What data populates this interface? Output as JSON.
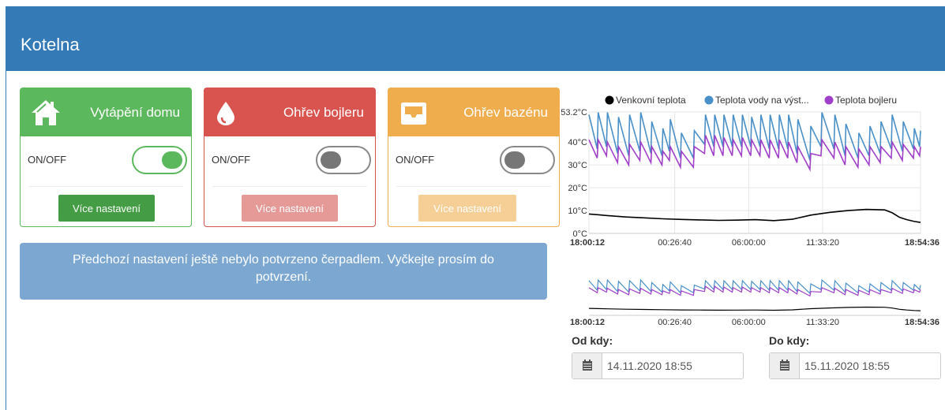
{
  "header": {
    "title": "Kotelna"
  },
  "cards": [
    {
      "title": "Vytápění domu",
      "toggle_label": "ON/OFF",
      "toggle_on": true,
      "button_label": "Více nastavení",
      "icon": "home-icon"
    },
    {
      "title": "Ohřev bojleru",
      "toggle_label": "ON/OFF",
      "toggle_on": false,
      "button_label": "Více nastavení",
      "icon": "water-drop-icon"
    },
    {
      "title": "Ohřev bazénu",
      "toggle_label": "ON/OFF",
      "toggle_on": false,
      "button_label": "Více nastavení",
      "icon": "inbox-tray-icon"
    }
  ],
  "alert": {
    "text": "Předchozí nastavení ještě nebylo potvrzeno čerpadlem. Vyčkejte prosím do potvrzení."
  },
  "colors": {
    "primary": "#337ab7",
    "success": "#5cb85c",
    "danger": "#d9534f",
    "warning": "#f0ad4e",
    "series_outdoor": "#000000",
    "series_water": "#4a90c8",
    "series_boiler": "#a040c8"
  },
  "chart_data": {
    "type": "line",
    "legend_position": "top",
    "y_axis_labels": [
      "53.2°C",
      "40°C",
      "30°C",
      "20°C",
      "10°C",
      "0°C"
    ],
    "y_ticks": [
      53.2,
      40,
      30,
      20,
      10,
      0
    ],
    "ylim": [
      0,
      53.2
    ],
    "x_tick_labels": [
      "18:00:12",
      "00:26:40",
      "06:00:00",
      "11:33:20",
      "18:54:36"
    ],
    "x_ticks": [
      0,
      23188,
      43188,
      63188,
      89664
    ],
    "xlim": [
      0,
      89664
    ],
    "grid": true,
    "navigator_x_tick_labels": [
      "18:00:12",
      "00:26:40",
      "06:00:00",
      "11:33:20",
      "18:54:36"
    ],
    "series": [
      {
        "name": "Venkovní teplota",
        "color": "#000000",
        "x": [
          0,
          5000,
          10000,
          15000,
          20000,
          25000,
          30000,
          35000,
          40000,
          45000,
          50000,
          55000,
          60000,
          65000,
          70000,
          75000,
          80000,
          82000,
          84000,
          86000,
          88000,
          89664
        ],
        "y": [
          8.5,
          7.8,
          7.2,
          6.8,
          6.4,
          6.1,
          5.9,
          5.7,
          5.8,
          6.0,
          5.6,
          6.2,
          8.0,
          9.2,
          10.0,
          10.5,
          10.3,
          9.0,
          7.0,
          6.0,
          5.2,
          4.8
        ]
      },
      {
        "name": "Teplota vody na výst...",
        "color": "#4a90c8",
        "peaks": [
          0,
          2500,
          5000,
          8000,
          11000,
          14000,
          17000,
          20000,
          22000,
          25000,
          28500,
          31500,
          34000,
          36500,
          39000,
          41500,
          44000,
          46500,
          49000,
          51500,
          54000,
          56500,
          60000,
          63000,
          66500,
          69500,
          73000,
          76000,
          79000,
          82000,
          85000,
          88000,
          89664
        ],
        "peak_y": [
          52,
          53,
          53,
          51,
          52,
          53,
          49,
          46,
          50,
          44,
          45,
          52,
          52,
          52,
          52,
          52,
          51,
          52,
          52,
          52,
          52,
          50,
          47,
          53,
          52,
          48,
          44,
          47,
          49,
          52,
          49,
          46,
          45
        ],
        "trough_y": [
          37,
          37,
          38,
          35,
          34,
          36,
          35,
          34,
          36,
          33,
          33,
          39,
          38,
          38,
          38,
          38,
          38,
          38,
          37,
          37,
          37,
          35,
          32,
          38,
          37,
          34,
          33,
          34,
          35,
          37,
          36,
          37,
          38
        ]
      },
      {
        "name": "Teplota bojleru",
        "color": "#a040c8",
        "peaks": [
          0,
          2500,
          5000,
          8000,
          11000,
          14000,
          17000,
          20000,
          22000,
          25000,
          28500,
          31500,
          34000,
          36500,
          39000,
          41500,
          44000,
          46500,
          49000,
          51500,
          54000,
          56500,
          60000,
          63000,
          66500,
          69500,
          73000,
          76000,
          79000,
          82000,
          85000,
          88000,
          89664
        ],
        "peak_y": [
          41,
          41,
          40,
          38,
          39,
          40,
          38,
          36,
          38,
          36,
          38,
          43,
          43,
          42,
          41,
          42,
          41,
          41,
          41,
          41,
          40,
          38,
          35,
          41,
          40,
          38,
          37,
          38,
          38,
          40,
          39,
          38,
          38
        ],
        "trough_y": [
          33,
          33,
          34,
          31,
          30,
          32,
          31,
          30,
          32,
          29,
          29,
          35,
          34,
          34,
          34,
          34,
          34,
          34,
          33,
          33,
          33,
          31,
          28,
          34,
          33,
          30,
          29,
          30,
          31,
          33,
          32,
          33,
          34
        ]
      }
    ]
  },
  "date_from": {
    "label": "Od kdy:",
    "value": "14.11.2020 18:55",
    "icon": "calendar-icon"
  },
  "date_to": {
    "label": "Do kdy:",
    "value": "15.11.2020 18:55",
    "icon": "calendar-icon"
  }
}
